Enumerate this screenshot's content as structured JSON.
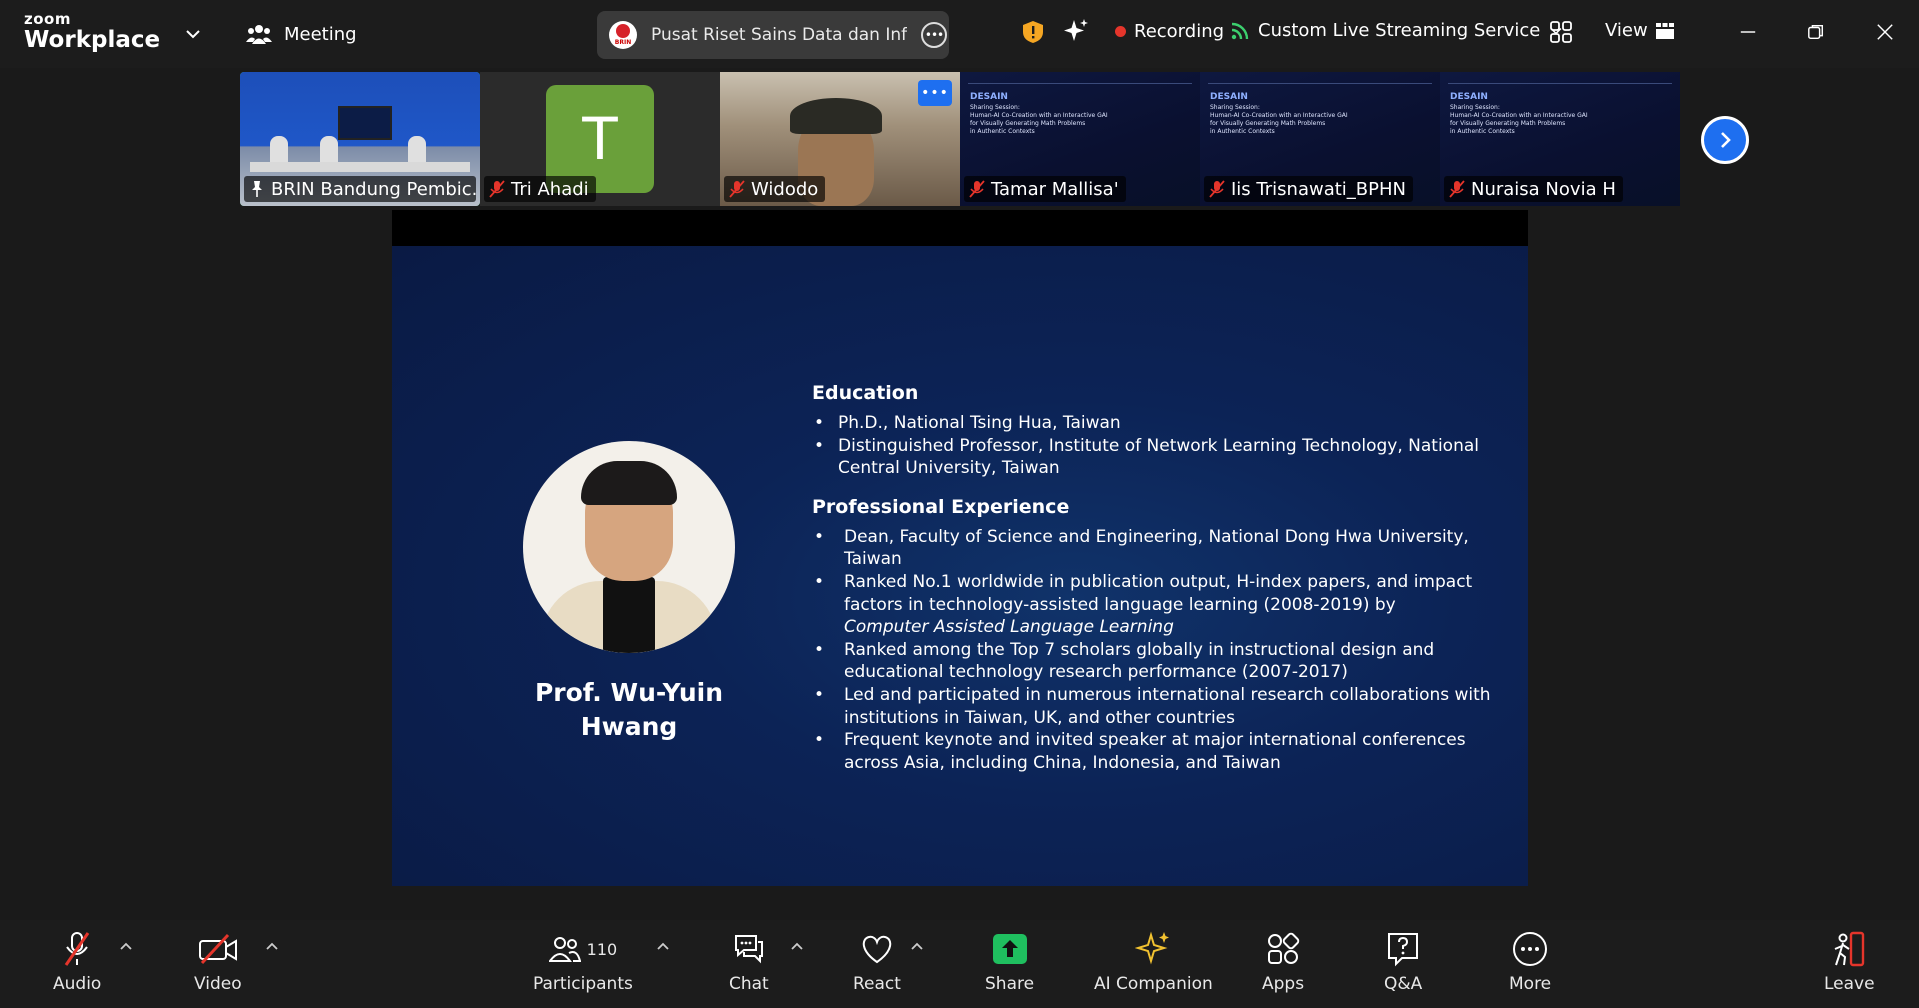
{
  "app": {
    "logo_line1": "zoom",
    "logo_line2": "Workplace"
  },
  "topbar": {
    "meeting_label": "Meeting",
    "meeting_title": "Pusat Riset Sains Data dan Inforr",
    "brin_label": "BRIN",
    "recording_label": "Recording",
    "stream_label": "Custom Live Streaming Service",
    "view_label": "View"
  },
  "participants": [
    {
      "name": "BRIN Bandung Pembic...",
      "type": "room",
      "pinned": true,
      "active": true
    },
    {
      "name": "Tri Ahadi",
      "type": "avatar",
      "initial": "T",
      "avatar_color": "#6aa03a"
    },
    {
      "name": "Widodo",
      "type": "video"
    },
    {
      "name": "Tamar Mallisa'",
      "type": "slide"
    },
    {
      "name": "Iis Trisnawati_BPHN",
      "type": "slide"
    },
    {
      "name": "Nuraisa Novia H",
      "type": "slide"
    }
  ],
  "thumb_slide": {
    "title": "DESAIN",
    "lines": [
      "Sharing Session:",
      "Human-AI Co-Creation with an Interactive GAI",
      "for Visually Generating Math Problems",
      "in Authentic Contexts"
    ]
  },
  "slide": {
    "name": "Prof. Wu-Yuin Hwang",
    "education": {
      "title": "Education",
      "items": [
        "Ph.D., National Tsing Hua, Taiwan",
        "Distinguished Professor, Institute of Network Learning Technology, National Central University, Taiwan"
      ]
    },
    "experience": {
      "title": "Professional Experience",
      "items": [
        "Dean, Faculty of Science and Engineering, National Dong Hwa University, Taiwan",
        "Ranked No.1 worldwide in publication output, H-index papers, and impact factors in technology-assisted language learning (2008-2019) by",
        "Ranked among the Top 7 scholars globally in instructional design and educational technology research performance (2007-2017)",
        "Led and participated in numerous international research collaborations with institutions in Taiwan, UK, and other countries",
        "Frequent keynote and invited speaker at major international conferences across Asia, including China, Indonesia, and Taiwan"
      ],
      "italic_suffix": "Computer Assisted Language Learning"
    }
  },
  "toolbar": {
    "audio": "Audio",
    "video": "Video",
    "participants": "Participants",
    "participants_count": "110",
    "chat": "Chat",
    "react": "React",
    "share": "Share",
    "ai_companion": "AI Companion",
    "apps": "Apps",
    "qa": "Q&A",
    "more": "More",
    "leave": "Leave"
  },
  "colors": {
    "accent": "#1e6ff0",
    "share_green": "#1fbf5f",
    "mute_red": "#e5352b",
    "active_border": "#28d17c"
  }
}
